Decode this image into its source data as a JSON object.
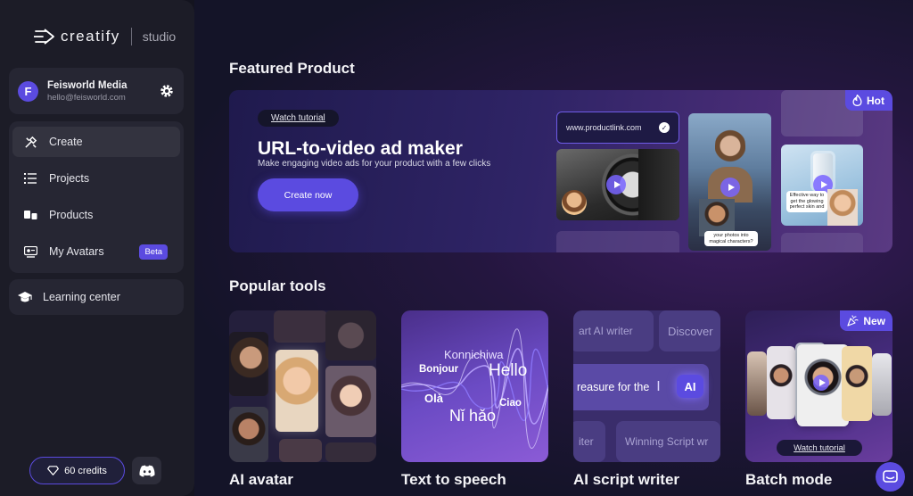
{
  "brand": {
    "name": "creatify",
    "product": "studio"
  },
  "account": {
    "initial": "F",
    "name": "Feisworld Media",
    "email": "hello@feisworld.com"
  },
  "nav": {
    "items": [
      {
        "label": "Create",
        "icon": "tools-icon",
        "active": true
      },
      {
        "label": "Projects",
        "icon": "list-icon",
        "active": false
      },
      {
        "label": "Products",
        "icon": "products-icon",
        "active": false
      },
      {
        "label": "My Avatars",
        "icon": "avatar-card-icon",
        "active": false,
        "badge": "Beta"
      }
    ],
    "learning": "Learning center"
  },
  "footer": {
    "credits": "60 credits",
    "discord_icon": "discord-icon"
  },
  "featured": {
    "section_title": "Featured Product",
    "watch_tutorial": "Watch tutorial",
    "title": "URL-to-video ad maker",
    "subtitle": "Make engaging video ads for your product with a few clicks",
    "cta": "Create now",
    "url": "www.productlink.com",
    "badge": "Hot",
    "caption_1": "your photos into magical characters?",
    "caption_2": "Effective way to get the glowing perfect skin and"
  },
  "popular": {
    "section_title": "Popular tools",
    "tools": [
      {
        "label": "AI avatar"
      },
      {
        "label": "Text to speech",
        "words": [
          "Konnichiwa",
          "Bonjour",
          "Hello",
          "Olà",
          "Ciao",
          "Nǐ hǎo"
        ]
      },
      {
        "label": "AI script writer",
        "pills": [
          "art AI writer",
          "Discover",
          "Winning Script wr",
          "iter"
        ],
        "input_text": "reasure for the",
        "chip": "AI"
      },
      {
        "label": "Batch mode",
        "badge": "New",
        "watch_tutorial": "Watch tutorial"
      }
    ]
  },
  "colors": {
    "accent": "#5b4be0",
    "sidebar": "#1c1c27",
    "panel": "#262633"
  }
}
